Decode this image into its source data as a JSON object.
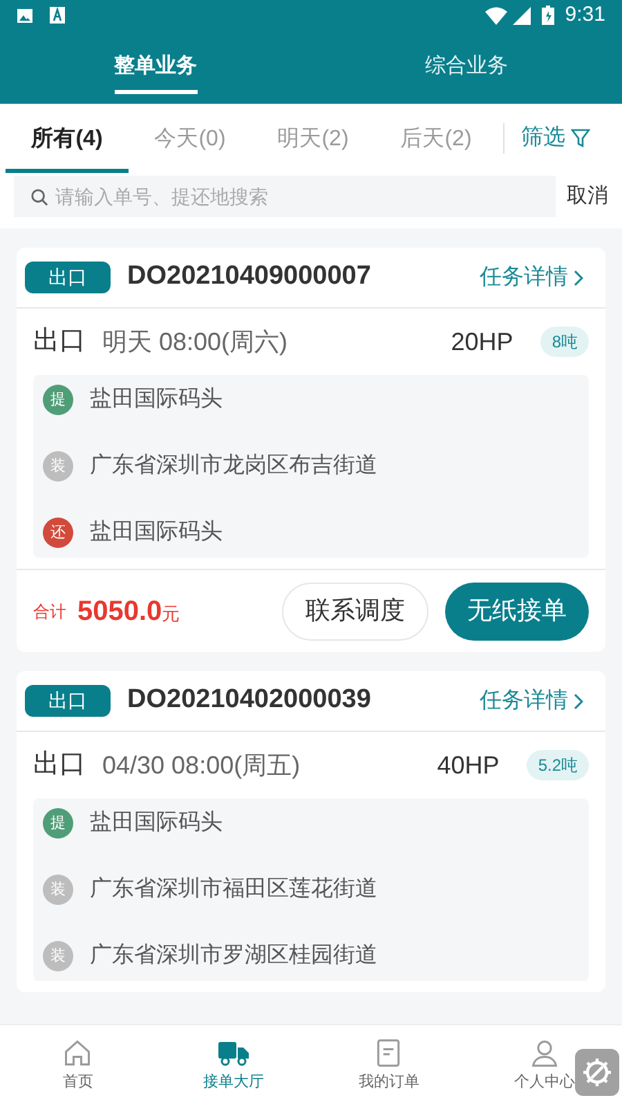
{
  "status_bar": {
    "time": "9:31"
  },
  "top_tabs": [
    {
      "label": "整单业务",
      "selected": true
    },
    {
      "label": "综合业务",
      "selected": false
    }
  ],
  "filter_tabs": [
    {
      "label": "所有(4)",
      "selected": true
    },
    {
      "label": "今天(0)",
      "selected": false
    },
    {
      "label": "明天(2)",
      "selected": false
    },
    {
      "label": "后天(2)",
      "selected": false
    }
  ],
  "filter_button": "筛选",
  "search": {
    "placeholder": "请输入单号、提还地搜索",
    "cancel": "取消"
  },
  "orders": [
    {
      "type_badge": "出口",
      "order_no": "DO20210409000007",
      "detail_link": "任务详情",
      "direction": "出口",
      "time": "明天 08:00(周六)",
      "container": "20HP",
      "weight": "8吨",
      "stops": [
        {
          "kind": "pickup",
          "badge": "提",
          "address": "盐田国际码头"
        },
        {
          "kind": "load",
          "badge": "装",
          "address": "广东省深圳市龙岗区布吉街道"
        },
        {
          "kind": "return",
          "badge": "还",
          "address": "盐田国际码头"
        }
      ],
      "total_label": "合计",
      "amount": "5050.0",
      "currency": "元",
      "buttons": [
        "联系调度",
        "无纸接单"
      ]
    },
    {
      "type_badge": "出口",
      "order_no": "DO20210402000039",
      "detail_link": "任务详情",
      "direction": "出口",
      "time": "04/30 08:00(周五)",
      "container": "40HP",
      "weight": "5.2吨",
      "stops": [
        {
          "kind": "pickup",
          "badge": "提",
          "address": "盐田国际码头"
        },
        {
          "kind": "load",
          "badge": "装",
          "address": "广东省深圳市福田区莲花街道"
        },
        {
          "kind": "load",
          "badge": "装",
          "address": "广东省深圳市罗湖区桂园街道"
        }
      ]
    }
  ],
  "bottom_nav": [
    {
      "kind": "home",
      "label": "首页",
      "selected": false
    },
    {
      "kind": "truck",
      "label": "接单大厅",
      "selected": true
    },
    {
      "kind": "orders",
      "label": "我的订单",
      "selected": false
    },
    {
      "kind": "user",
      "label": "个人中心",
      "selected": false
    }
  ]
}
